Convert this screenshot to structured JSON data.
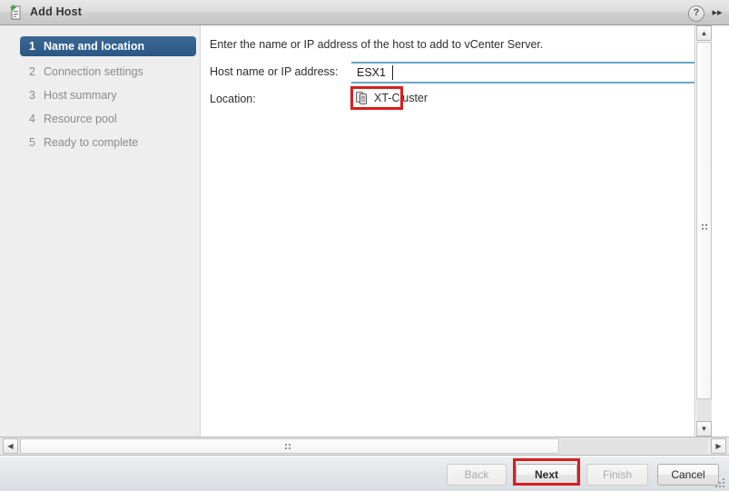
{
  "window": {
    "title": "Add Host",
    "title_icon": "add-host-icon",
    "help_label": "?",
    "expand_label": "▸▸"
  },
  "sidebar": {
    "steps": [
      {
        "num": "1",
        "label": "Name and location",
        "active": true
      },
      {
        "num": "2",
        "label": "Connection settings",
        "active": false
      },
      {
        "num": "3",
        "label": "Host summary",
        "active": false
      },
      {
        "num": "4",
        "label": "Resource pool",
        "active": false
      },
      {
        "num": "5",
        "label": "Ready to complete",
        "active": false
      }
    ]
  },
  "main": {
    "intro": "Enter the name or IP address of the host to add to vCenter Server.",
    "host_label": "Host name or IP address:",
    "host_value": "ESX1",
    "host_placeholder": "",
    "location_label": "Location:",
    "location_icon": "cluster-icon",
    "location_value": "XT-Cluster"
  },
  "footer": {
    "back": "Back",
    "next": "Next",
    "finish": "Finish",
    "cancel": "Cancel"
  },
  "scrollbars": {
    "v_up": "▲",
    "v_down": "▼",
    "h_left": "◀",
    "h_right": "▶"
  },
  "annotations": {
    "accent": "#d81e1e",
    "selected_step_bg": "#2b5c8a",
    "input_border": "#6aa5c4"
  }
}
